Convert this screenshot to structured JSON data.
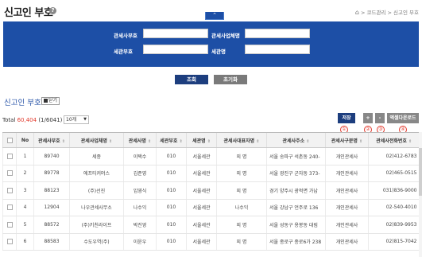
{
  "header": {
    "title": "신고인 부호",
    "help_icon": "question-circle-icon",
    "breadcrumb": [
      "코드관리",
      "신고인 부호"
    ]
  },
  "search": {
    "toggle_icon": "chevron-up-icon",
    "fields": [
      {
        "label": "관세사부호",
        "value": ""
      },
      {
        "label": "관세사업체명",
        "value": ""
      },
      {
        "label": "세관부호",
        "value": ""
      },
      {
        "label": "세관명",
        "value": ""
      }
    ],
    "search_label": "조회",
    "reset_label": "초기화"
  },
  "section": {
    "title": "신고인 부호",
    "close_label": "닫기"
  },
  "summary": {
    "prefix": "Total",
    "count": "60,404",
    "pages": "(1/6041)",
    "page_size": "10개"
  },
  "toolbar": {
    "save_label": "저장",
    "add_label": "+",
    "remove_label": "-",
    "excel_label": "엑셀다운로드"
  },
  "markers": [
    "①",
    "②",
    "③",
    "④"
  ],
  "table": {
    "columns": [
      "No",
      "관세사부호",
      "관세사업체명",
      "관세사명",
      "세관부호",
      "세관명",
      "관세사대표자명",
      "관세사주소",
      "관세사구분명",
      "관세사전화번호"
    ],
    "rows": [
      [
        "1",
        "89740",
        "세종",
        "이택수",
        "010",
        "서울세관",
        "외 명",
        "서울 송파구 석촌동 240-",
        "개인관세사",
        "02)412-6783"
      ],
      [
        "2",
        "89778",
        "에프티커머스",
        "김준영",
        "010",
        "서울세관",
        "외 명",
        "서울 광진구 군자동 373-",
        "개인관세사",
        "02)465-0515"
      ],
      [
        "3",
        "88123",
        "(주)선진",
        "임영식",
        "010",
        "서울세관",
        "외 명",
        "경기 양주시 광적면 가납",
        "개인관세사",
        "031)836-9000"
      ],
      [
        "4",
        "12904",
        "나우관세사무소",
        "나수익",
        "010",
        "서울세관",
        "나수익",
        "서울 강남구 언주로 136",
        "개인관세사",
        "02-540-4010"
      ],
      [
        "5",
        "88572",
        "(주)키친라이프",
        "박진영",
        "010",
        "서울세관",
        "외 명",
        "서울 성동구 용봉동 대림",
        "개인관세사",
        "02)839-9953"
      ],
      [
        "6",
        "88583",
        "수도우역(주)",
        "이윤우",
        "010",
        "서울세관",
        "외 명",
        "서울 종로구 종로6가 238",
        "개인관세사",
        "02)815-7042"
      ]
    ]
  }
}
